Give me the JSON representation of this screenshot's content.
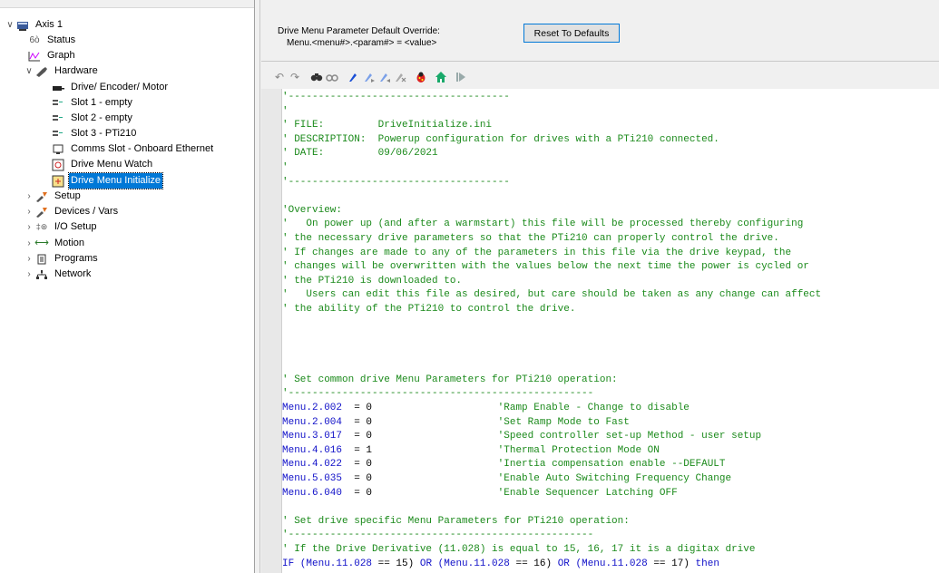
{
  "tree": {
    "items": [
      {
        "label": "Axis 1",
        "icon": "axis-icon",
        "expander": "∨",
        "level": 0
      },
      {
        "label": "Status",
        "icon": "status-icon",
        "expander": "",
        "level": 1
      },
      {
        "label": "Graph",
        "icon": "graph-icon",
        "expander": "",
        "level": 1
      },
      {
        "label": "Hardware",
        "icon": "hardware-icon",
        "expander": "∨",
        "level": 1
      },
      {
        "label": "Drive/ Encoder/ Motor",
        "icon": "motor-icon",
        "expander": "",
        "level": 2
      },
      {
        "label": "Slot 1 - empty",
        "icon": "slot-icon",
        "expander": "",
        "level": 2
      },
      {
        "label": "Slot 2 - empty",
        "icon": "slot-icon",
        "expander": "",
        "level": 2
      },
      {
        "label": "Slot 3 - PTi210",
        "icon": "slot-icon",
        "expander": "",
        "level": 2
      },
      {
        "label": "Comms Slot - Onboard Ethernet",
        "icon": "ethernet-icon",
        "expander": "",
        "level": 2
      },
      {
        "label": "Drive Menu Watch",
        "icon": "menu-watch-icon",
        "expander": "",
        "level": 2
      },
      {
        "label": "Drive Menu Initialize",
        "icon": "menu-init-icon",
        "expander": "",
        "level": 2,
        "selected": true
      },
      {
        "label": "Setup",
        "icon": "setup-icon",
        "expander": "›",
        "level": 0
      },
      {
        "label": "Devices / Vars",
        "icon": "devices-icon",
        "expander": "›",
        "level": 0
      },
      {
        "label": "I/O Setup",
        "icon": "io-icon",
        "expander": "›",
        "level": 0
      },
      {
        "label": "Motion",
        "icon": "motion-icon",
        "expander": "›",
        "level": 0
      },
      {
        "label": "Programs",
        "icon": "programs-icon",
        "expander": "›",
        "level": 0
      },
      {
        "label": "Network",
        "icon": "network-icon",
        "expander": "›",
        "level": 0
      }
    ]
  },
  "header": {
    "line1": "Drive Menu Parameter Default Override:",
    "line2": "Menu.<menu#>.<param#> = <value>",
    "reset_label": "Reset To Defaults"
  },
  "toolbar": {
    "icons": [
      "undo-icon",
      "redo-icon",
      "find-icon",
      "find-replace-icon",
      "bookmark-icon",
      "bookmark-next-icon",
      "bookmark-prev-icon",
      "bookmark-clear-icon",
      "debug-icon",
      "home-icon",
      "run-icon"
    ]
  },
  "code": {
    "lines": [
      [
        [
          "c-cmt",
          "'-------------------------------------"
        ]
      ],
      [
        [
          "c-cmt",
          "'"
        ]
      ],
      [
        [
          "c-cmt",
          "' FILE:         DriveInitialize.ini"
        ]
      ],
      [
        [
          "c-cmt",
          "' DESCRIPTION:  Powerup configuration for drives with a PTi210 connected."
        ]
      ],
      [
        [
          "c-cmt",
          "' DATE:         09/06/2021"
        ]
      ],
      [
        [
          "c-cmt",
          "'"
        ]
      ],
      [
        [
          "c-cmt",
          "'-------------------------------------"
        ]
      ],
      [
        [
          "c-cmt",
          ""
        ]
      ],
      [
        [
          "c-cmt",
          "'Overview:"
        ]
      ],
      [
        [
          "c-cmt",
          "'   On power up (and after a warmstart) this file will be processed thereby configuring"
        ]
      ],
      [
        [
          "c-cmt",
          "' the necessary drive parameters so that the PTi210 can properly control the drive."
        ]
      ],
      [
        [
          "c-cmt",
          "' If changes are made to any of the parameters in this file via the drive keypad, the"
        ]
      ],
      [
        [
          "c-cmt",
          "' changes will be overwritten with the values below the next time the power is cycled or"
        ]
      ],
      [
        [
          "c-cmt",
          "' the PTi210 is downloaded to."
        ]
      ],
      [
        [
          "c-cmt",
          "'   Users can edit this file as desired, but care should be taken as any change can affect"
        ]
      ],
      [
        [
          "c-cmt",
          "' the ability of the PTi210 to control the drive."
        ]
      ],
      [
        [
          "c-cmt",
          ""
        ]
      ],
      [
        [
          "c-cmt",
          ""
        ]
      ],
      [
        [
          "c-cmt",
          ""
        ]
      ],
      [
        [
          "c-cmt",
          ""
        ]
      ],
      [
        [
          "c-cmt",
          "' Set common drive Menu Parameters for PTi210 operation:"
        ]
      ],
      [
        [
          "c-cmt",
          "'---------------------------------------------------"
        ]
      ],
      [
        [
          "c-var",
          "Menu.2.002"
        ],
        [
          "c-op",
          "  = 0                     "
        ],
        [
          "c-cmt",
          "'Ramp Enable - Change to disable"
        ]
      ],
      [
        [
          "c-var",
          "Menu.2.004"
        ],
        [
          "c-op",
          "  = 0                     "
        ],
        [
          "c-cmt",
          "'Set Ramp Mode to Fast"
        ]
      ],
      [
        [
          "c-var",
          "Menu.3.017"
        ],
        [
          "c-op",
          "  = 0                     "
        ],
        [
          "c-cmt",
          "'Speed controller set-up Method - user setup"
        ]
      ],
      [
        [
          "c-var",
          "Menu.4.016"
        ],
        [
          "c-op",
          "  = 1                     "
        ],
        [
          "c-cmt",
          "'Thermal Protection Mode ON"
        ]
      ],
      [
        [
          "c-var",
          "Menu.4.022"
        ],
        [
          "c-op",
          "  = 0                     "
        ],
        [
          "c-cmt",
          "'Inertia compensation enable --DEFAULT"
        ]
      ],
      [
        [
          "c-var",
          "Menu.5.035"
        ],
        [
          "c-op",
          "  = 0                     "
        ],
        [
          "c-cmt",
          "'Enable Auto Switching Frequency Change"
        ]
      ],
      [
        [
          "c-var",
          "Menu.6.040"
        ],
        [
          "c-op",
          "  = 0                     "
        ],
        [
          "c-cmt",
          "'Enable Sequencer Latching OFF"
        ]
      ],
      [
        [
          "c-cmt",
          ""
        ]
      ],
      [
        [
          "c-cmt",
          "' Set drive specific Menu Parameters for PTi210 operation:"
        ]
      ],
      [
        [
          "c-cmt",
          "'---------------------------------------------------"
        ]
      ],
      [
        [
          "c-cmt",
          "' If the Drive Derivative (11.028) is equal to 15, 16, 17 it is a digitax drive"
        ]
      ],
      [
        [
          "c-kw",
          "IF ("
        ],
        [
          "c-var",
          "Menu.11.028"
        ],
        [
          "c-op",
          " == 15) "
        ],
        [
          "c-kw",
          "OR ("
        ],
        [
          "c-var",
          "Menu.11.028"
        ],
        [
          "c-op",
          " == 16) "
        ],
        [
          "c-kw",
          "OR ("
        ],
        [
          "c-var",
          "Menu.11.028"
        ],
        [
          "c-op",
          " == 17) "
        ],
        [
          "c-kw",
          "then"
        ]
      ]
    ]
  },
  "colors": {
    "selection": "#0078d7",
    "comment": "#1b8a1b",
    "keyword": "#1010c8"
  }
}
